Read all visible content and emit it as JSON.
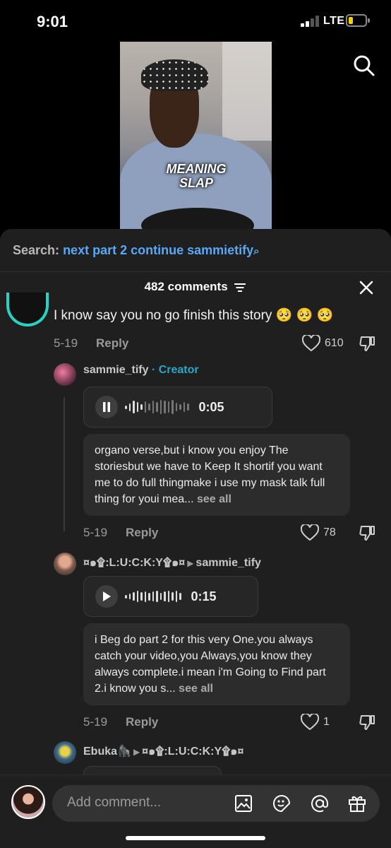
{
  "status_bar": {
    "time": "9:01",
    "network": "LTE",
    "battery_color": "#f4d100"
  },
  "video": {
    "caption_line1": "MEANING",
    "caption_line2": "SLAP"
  },
  "search_bar": {
    "label": "Search:",
    "query": "next part 2 continue sammietify",
    "search_icon": "search-icon"
  },
  "header": {
    "comments_count": "482 comments",
    "filter_icon": "filter-icon",
    "close_icon": "close-icon"
  },
  "comments": [
    {
      "text": "I know say you no go finish this story 🥺 🥺 🥺",
      "date": "5-19",
      "reply_label": "Reply",
      "likes": "610"
    },
    {
      "username": "sammie_tify",
      "badge": "· Creator",
      "voice_duration": "0:05",
      "voice_state": "pause",
      "text": "organo verse,but i know you enjoy The storiesbut we have to Keep It shortif you want me to do full thingmake i use my mask talk full thing for youi mea...",
      "see_all": "see all",
      "date": "5-19",
      "reply_label": "Reply",
      "likes": "78"
    },
    {
      "username": "¤๑۩:L:U:C:K:Y۩๑¤",
      "reply_to": "sammie_tify",
      "voice_duration": "0:15",
      "voice_state": "play",
      "text": "i Beg do part 2 for this very One.you always catch your video,you Always,you know they always complete.i mean i'm Going to Find part 2.i know you s...",
      "see_all": "see all",
      "date": "5-19",
      "reply_label": "Reply",
      "likes": "1"
    },
    {
      "username": "Ebuka🦍",
      "reply_to": "¤๑۩:L:U:C:K:Y۩๑¤"
    }
  ],
  "composer": {
    "placeholder": "Add comment...",
    "icons": [
      "image-icon",
      "sticker-icon",
      "mention-icon",
      "gift-icon"
    ]
  },
  "colors": {
    "link_blue": "#5aa8f5",
    "creator_teal": "#28a7c9",
    "ring_teal": "#27d3c3"
  }
}
